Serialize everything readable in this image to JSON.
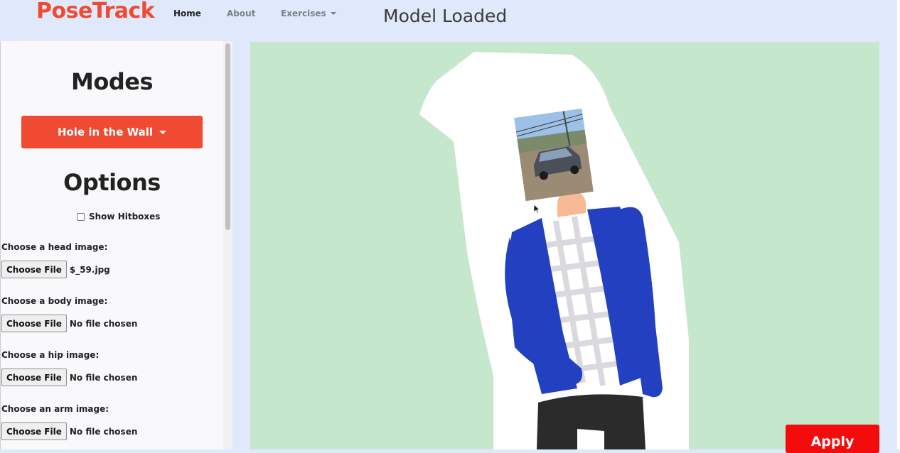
{
  "navbar": {
    "brand": "PoseTrack",
    "links": [
      {
        "label": "Home",
        "active": true
      },
      {
        "label": "About",
        "active": false
      },
      {
        "label": "Exercises",
        "active": false,
        "dropdown": true
      }
    ],
    "status": "Model Loaded"
  },
  "sidebar": {
    "modes_title": "Modes",
    "mode_button_label": "Hole in the Wall",
    "options_title": "Options",
    "show_hitboxes_label": "Show Hitboxes",
    "show_hitboxes_checked": false,
    "file_inputs": [
      {
        "label": "Choose a head image:",
        "button": "Choose File",
        "value": "$_59.jpg"
      },
      {
        "label": "Choose a body image:",
        "button": "Choose File",
        "value": "No file chosen"
      },
      {
        "label": "Choose a hip image:",
        "button": "Choose File",
        "value": "No file chosen"
      },
      {
        "label": "Choose an arm image:",
        "button": "Choose File",
        "value": "No file chosen"
      }
    ]
  },
  "main": {
    "apply_label": "Apply"
  },
  "colors": {
    "brand": "#f04a32",
    "canvas_bg": "#c5e8cc",
    "jacket": "#2340c0",
    "apply": "#f40b0b"
  },
  "icons": [
    "caret-down-icon",
    "cursor-arrow-icon"
  ]
}
